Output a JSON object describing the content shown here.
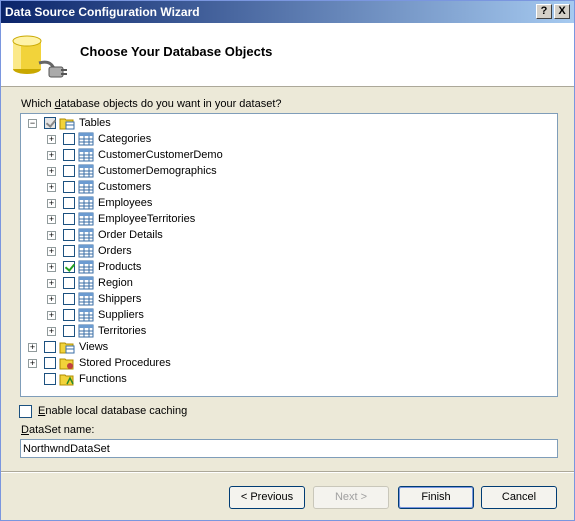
{
  "window": {
    "title": "Data Source Configuration Wizard",
    "help_label": "?",
    "close_label": "X"
  },
  "header": {
    "title": "Choose Your Database Objects",
    "icon": "database-plug-icon"
  },
  "question": {
    "prefix": "Which ",
    "underlined": "d",
    "suffix": "atabase objects do you want in your dataset?"
  },
  "tree": {
    "root": {
      "label": "Tables",
      "checked": "partial",
      "icon": "tables-folder-icon"
    },
    "tables": [
      {
        "label": "Categories",
        "checked": false
      },
      {
        "label": "CustomerCustomerDemo",
        "checked": false
      },
      {
        "label": "CustomerDemographics",
        "checked": false
      },
      {
        "label": "Customers",
        "checked": false
      },
      {
        "label": "Employees",
        "checked": false
      },
      {
        "label": "EmployeeTerritories",
        "checked": false
      },
      {
        "label": "Order Details",
        "checked": false
      },
      {
        "label": "Orders",
        "checked": false
      },
      {
        "label": "Products",
        "checked": true
      },
      {
        "label": "Region",
        "checked": false
      },
      {
        "label": "Shippers",
        "checked": false
      },
      {
        "label": "Suppliers",
        "checked": false
      },
      {
        "label": "Territories",
        "checked": false
      }
    ],
    "folders": [
      {
        "label": "Views",
        "checked": false,
        "expandable": true
      },
      {
        "label": "Stored Procedures",
        "checked": false,
        "expandable": true
      },
      {
        "label": "Functions",
        "checked": false,
        "expandable": false
      }
    ]
  },
  "caching": {
    "underlined": "E",
    "rest": "nable local database caching",
    "checked": false
  },
  "dataset": {
    "label_underlined": "D",
    "label_rest": "ataSet name:",
    "value": "NorthwndDataSet"
  },
  "buttons": {
    "previous": "< Previous",
    "next": "Next >",
    "finish": "Finish",
    "cancel": "Cancel"
  }
}
